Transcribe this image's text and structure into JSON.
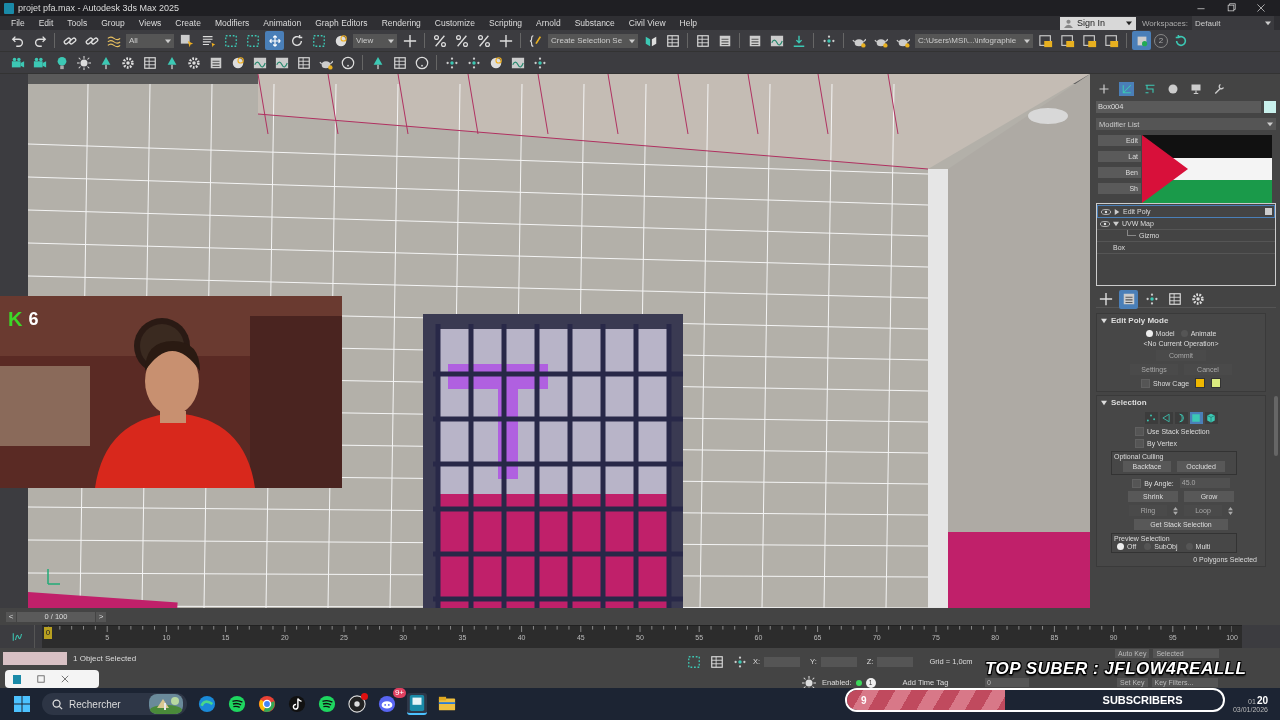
{
  "window": {
    "title": "projet pfa.max - Autodesk 3ds Max 2025"
  },
  "menu": [
    "File",
    "Edit",
    "Tools",
    "Group",
    "Views",
    "Create",
    "Modifiers",
    "Animation",
    "Graph Editors",
    "Rendering",
    "Customize",
    "Scripting",
    "Arnold",
    "Substance",
    "Civil View",
    "Help"
  ],
  "account": {
    "sign_in": "Sign In",
    "workspaces_label": "Workspaces:",
    "workspace": "Default"
  },
  "toolbar": {
    "selection_filter": "All",
    "reference_coord": "View",
    "named_selection": "Create Selection Se",
    "project_path": "C:\\Users\\MSI\\...\\infographie",
    "badge": "2"
  },
  "webcam": {
    "badge_letter": "K",
    "badge_count": "6"
  },
  "command_panel": {
    "tabs": [
      {
        "selected": false
      },
      {
        "selected": true
      },
      {
        "selected": false
      },
      {
        "selected": false
      },
      {
        "selected": false
      },
      {
        "selected": false
      }
    ],
    "object_name": "Box004",
    "modifier_list": "Modifier List",
    "modifier_buttons": [
      "Edit",
      "Lat",
      "Ben",
      "Sh"
    ],
    "stack": [
      {
        "label": "Edit Poly",
        "kind": "modifier",
        "selected": true,
        "expanded": false
      },
      {
        "label": "UVW Map",
        "kind": "modifier",
        "selected": false,
        "expanded": true,
        "children": [
          {
            "label": "Gizmo",
            "kind": "sub",
            "selected": false
          }
        ]
      },
      {
        "label": "Box",
        "kind": "base",
        "selected": false
      }
    ],
    "edit_poly_mode": {
      "title": "Edit Poly Mode",
      "expanded": true,
      "modes": [
        {
          "label": "Model",
          "selected": true
        },
        {
          "label": "Animate",
          "selected": false
        }
      ],
      "operation": "<No Current Operation>",
      "buttons": [
        {
          "label": "Commit",
          "disabled": true
        },
        {
          "label": "Settings",
          "disabled": true
        },
        {
          "label": "Cancel",
          "disabled": true
        }
      ],
      "show_cage": {
        "label": "Show Cage",
        "checked": false
      }
    },
    "selection": {
      "title": "Selection",
      "expanded": true,
      "levels": [
        {
          "kind": "vertex",
          "selected": false
        },
        {
          "kind": "edge",
          "selected": false
        },
        {
          "kind": "border",
          "selected": false
        },
        {
          "kind": "polygon",
          "selected": true
        },
        {
          "kind": "element",
          "selected": false
        }
      ],
      "checks": [
        {
          "label": "Use Stack Selection",
          "checked": false
        },
        {
          "label": "By Vertex",
          "checked": false
        }
      ],
      "culling": {
        "title": "Optional Culling",
        "buttons": [
          "Backface",
          "Occluded"
        ]
      },
      "by_angle": {
        "label": "By Angle:",
        "checked": false,
        "value": "45.0",
        "disabled": true
      },
      "grow_buttons": [
        "Shrink",
        "Grow"
      ],
      "ring_loop": [
        {
          "label": "Ring",
          "disabled": true
        },
        {
          "label": "Loop",
          "disabled": true
        }
      ],
      "get_stack": "Get Stack Selection",
      "preview": {
        "title": "Preview Selection",
        "options": [
          {
            "label": "Off",
            "selected": true
          },
          {
            "label": "SubObj",
            "selected": false
          },
          {
            "label": "Multi",
            "selected": false
          }
        ]
      },
      "status": "0 Polygons Selected"
    }
  },
  "timeline": {
    "prev": "<",
    "frame": "0 / 100",
    "next": ">",
    "current": "0",
    "ticks": [
      "5",
      "10",
      "15",
      "20",
      "25",
      "30",
      "35",
      "40",
      "45",
      "50",
      "55",
      "60",
      "65",
      "70",
      "75",
      "80",
      "85",
      "90",
      "95",
      "100"
    ]
  },
  "status_bar": {
    "selection": "1 Object Selected",
    "x_label": "X:",
    "y_label": "Y:",
    "z_label": "Z:",
    "grid": "Grid = 1,0cm",
    "enabled_label": "Enabled:",
    "enabled": true,
    "isolate_count": "1",
    "time_tag": "Add Time Tag",
    "auto_key": "Auto Key",
    "key_mode": "Selected",
    "frame_field": "0",
    "set_key": "Set Key",
    "key_filters": "Key Filters..."
  },
  "overlay": {
    "top_sub": "TOP SUBER : JFLOW4REALLL",
    "subscribers": {
      "count": "9",
      "label": "SUBSCRIBERS",
      "level": 0.42
    }
  },
  "taskbar": {
    "search_placeholder": "Rechercher",
    "apps": [
      {
        "kind": "edge",
        "active": false,
        "alert": false
      },
      {
        "kind": "music",
        "active": false,
        "alert": false
      },
      {
        "kind": "browser",
        "active": false,
        "alert": false
      },
      {
        "kind": "note",
        "active": false,
        "alert": false
      },
      {
        "kind": "music",
        "active": false,
        "alert": false
      },
      {
        "kind": "recorder",
        "active": false,
        "alert": true
      },
      {
        "kind": "chat",
        "active": false,
        "alert": false,
        "badge": "9+"
      },
      {
        "kind": "max",
        "active": true,
        "alert": false
      },
      {
        "kind": "folder",
        "active": false,
        "alert": false
      }
    ],
    "clock": {
      "hours": "01",
      "minutes": "20",
      "date": "03/01/2026"
    }
  }
}
